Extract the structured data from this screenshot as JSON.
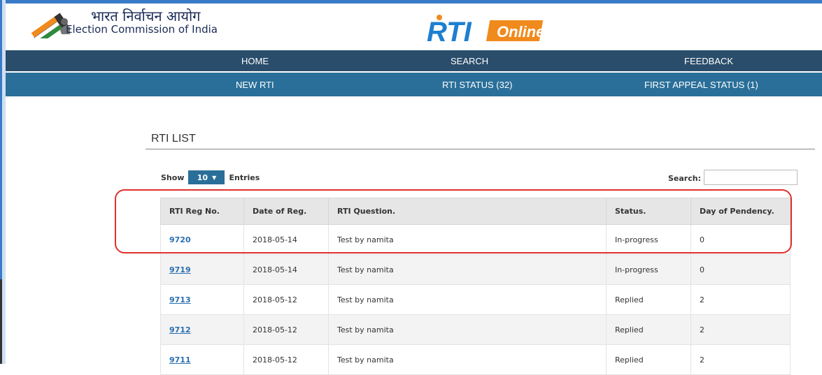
{
  "header": {
    "hindi_title": "भारत निर्वाचन आयोग",
    "english_title": "Election Commission of India",
    "rti_logo_text": "RTI",
    "rti_online_text": "Online"
  },
  "nav_top": [
    {
      "label": "HOME"
    },
    {
      "label": "SEARCH"
    },
    {
      "label": "FEEDBACK"
    }
  ],
  "nav_bottom": [
    {
      "label": "NEW RTI"
    },
    {
      "label": "RTI STATUS (32)"
    },
    {
      "label": "FIRST APPEAL STATUS (1)"
    }
  ],
  "list": {
    "title": "RTI LIST",
    "show_label": "Show",
    "entries_value": "10",
    "entries_label": "Entries",
    "search_label": "Search:",
    "search_value": ""
  },
  "table": {
    "headers": [
      "RTI Reg No.",
      "Date of Reg.",
      "RTI Question.",
      "Status.",
      "Day of Pendency."
    ],
    "rows": [
      [
        "9720",
        "2018-05-14",
        "Test by namita",
        "In-progress",
        "0"
      ],
      [
        "9719",
        "2018-05-14",
        "Test by namita",
        "In-progress",
        "0"
      ],
      [
        "9713",
        "2018-05-12",
        "Test by namita",
        "Replied",
        "2"
      ],
      [
        "9712",
        "2018-05-12",
        "Test by namita",
        "Replied",
        "2"
      ],
      [
        "9711",
        "2018-05-12",
        "Test by namita",
        "Replied",
        "2"
      ]
    ]
  },
  "colors": {
    "nav_top_bg": "#2a4d6b",
    "nav_bottom_bg": "#2a6f99",
    "link": "#2a6fb0",
    "highlight": "#e0312e",
    "rti_logo_blue": "#1e7fd0",
    "rti_logo_orange": "#f08a1c"
  }
}
